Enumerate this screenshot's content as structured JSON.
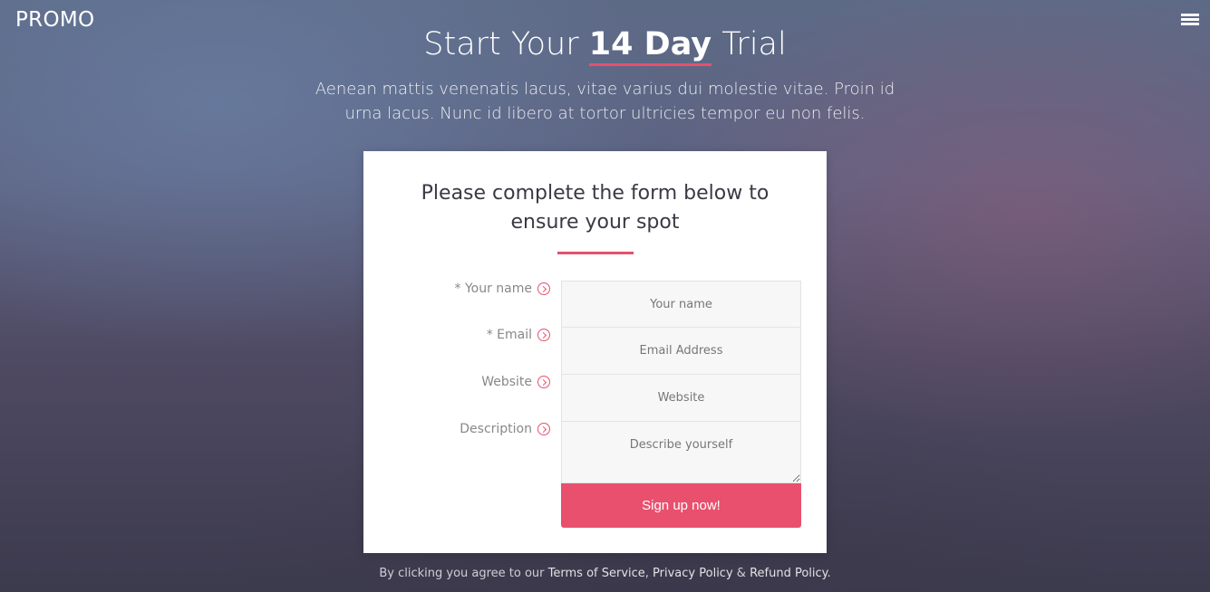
{
  "brand": "PROMO",
  "menu_icon": "hamburger-menu-icon",
  "hero": {
    "title_prefix": "Start Your ",
    "title_highlight": "14 Day",
    "title_suffix": " Trial",
    "subtitle": "Aenean mattis venenatis lacus, vitae varius dui molestie vitae. Proin id urna lacus. Nunc id libero at tortor ultricies tempor eu non felis."
  },
  "form": {
    "heading": "Please complete the form below to ensure your spot",
    "fields": [
      {
        "label": "* Your name",
        "placeholder": "Your name"
      },
      {
        "label": "* Email",
        "placeholder": "Email Address"
      },
      {
        "label": "Website",
        "placeholder": "Website"
      },
      {
        "label": "Description",
        "placeholder": "Describe yourself"
      }
    ],
    "submit_label": "Sign up now!"
  },
  "footer": {
    "prefix": "By clicking you agree to our ",
    "terms": "Terms of Service",
    "sep1": ", ",
    "privacy": "Privacy Policy",
    "sep2": " & ",
    "refund": "Refund Policy",
    "suffix": "."
  },
  "colors": {
    "accent": "#e8506e",
    "card_bg": "#ffffff",
    "input_bg": "#f7f7f7"
  }
}
